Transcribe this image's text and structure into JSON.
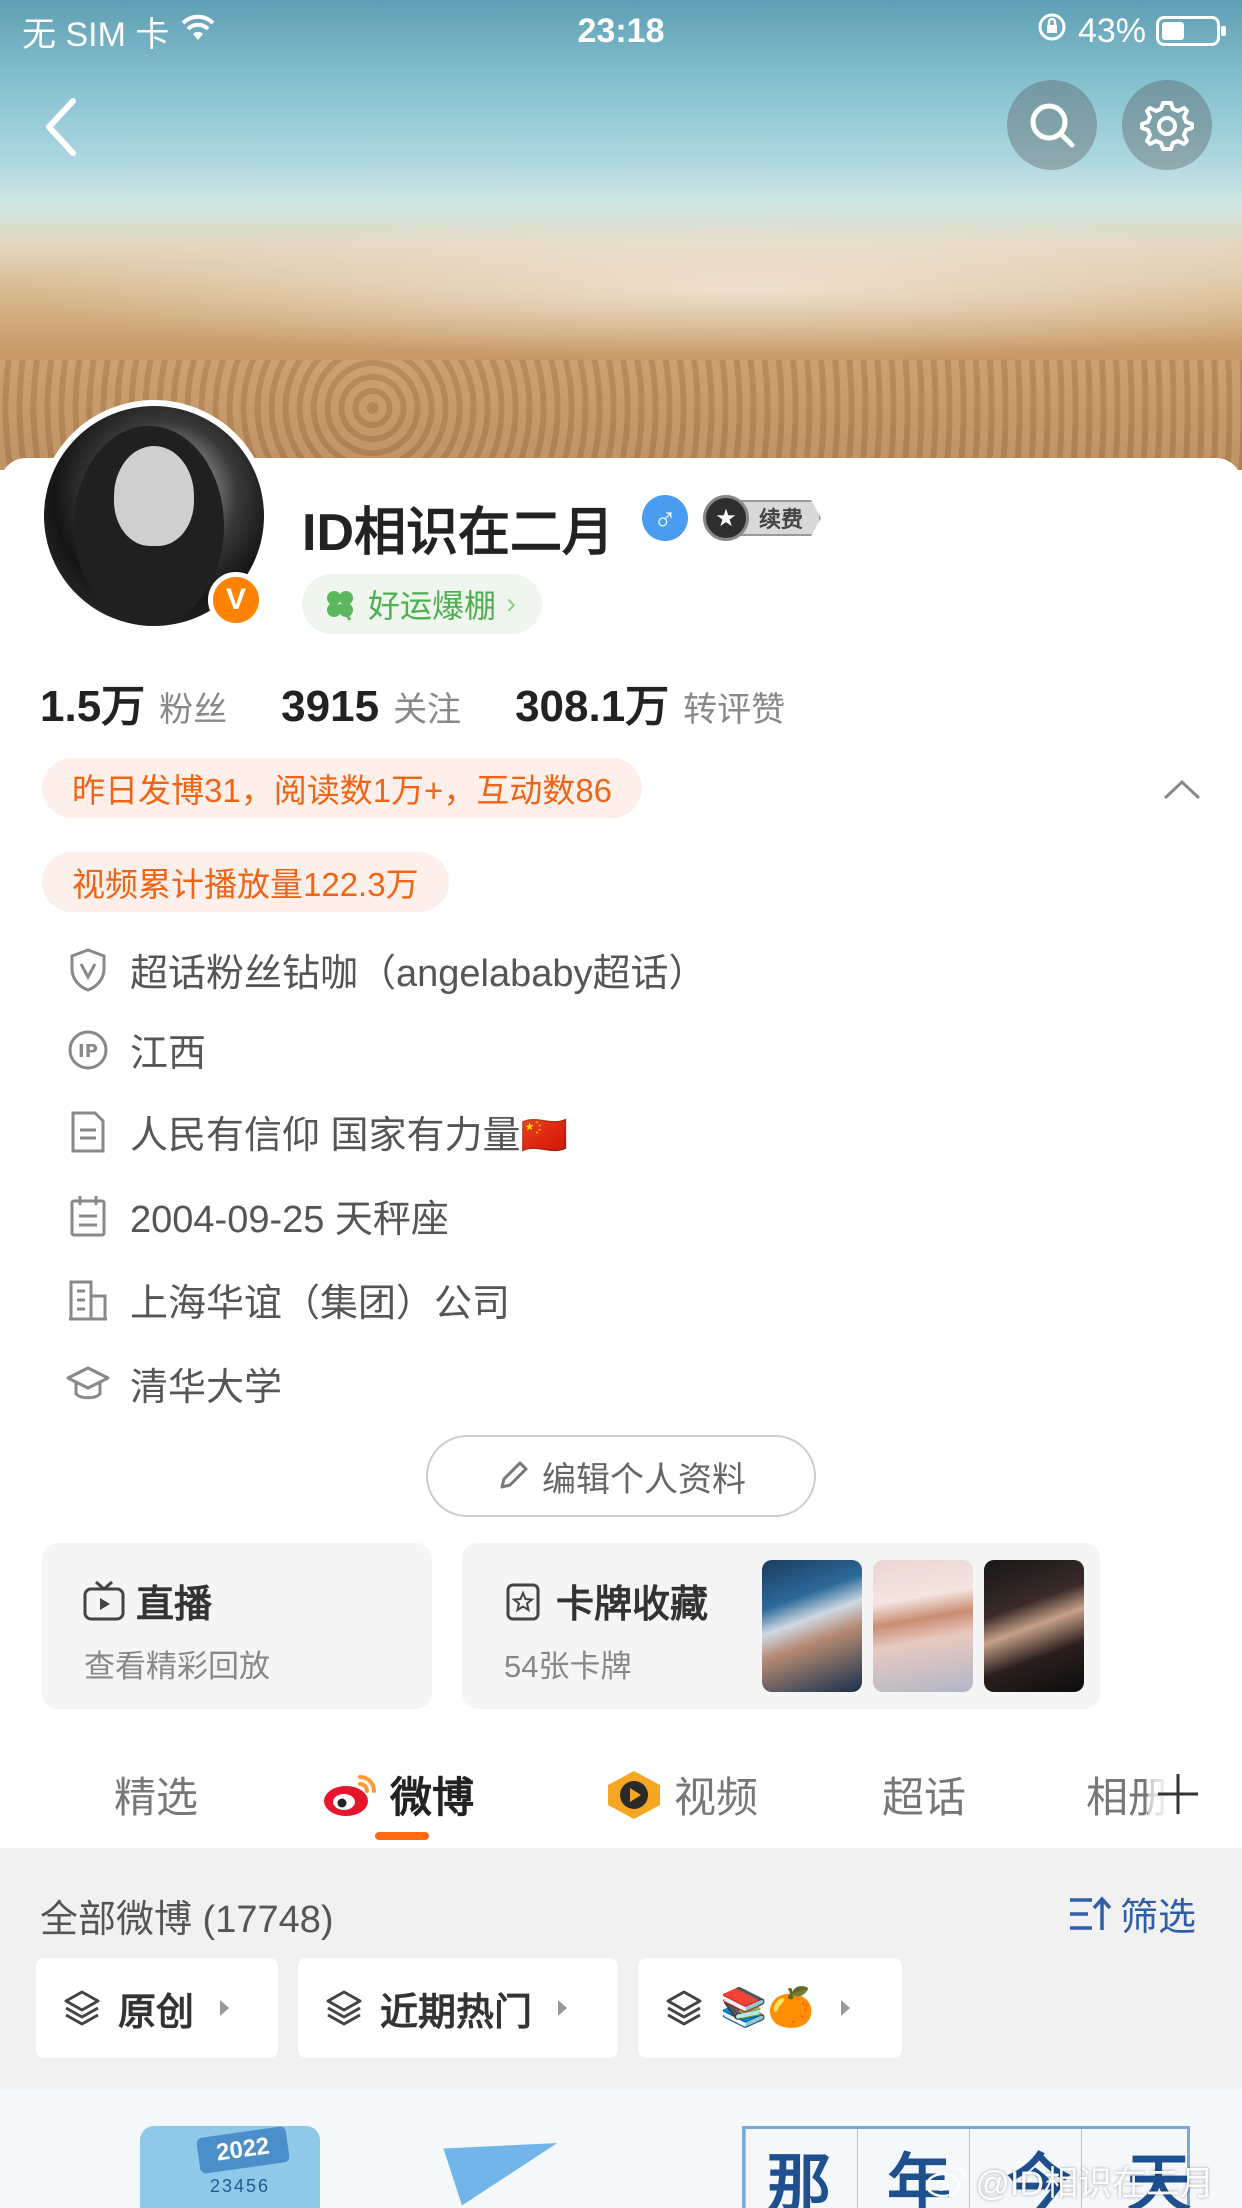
{
  "status_bar": {
    "carrier": "无 SIM 卡",
    "time": "23:18",
    "battery_pct": "43%",
    "battery_level": 0.43
  },
  "profile": {
    "name": "ID相识在二月",
    "member_badge": "续费",
    "luck_label": "好运爆棚",
    "verified_letter": "V"
  },
  "stats": [
    {
      "value": "1.5万",
      "label": "粉丝"
    },
    {
      "value": "3915",
      "label": "关注"
    },
    {
      "value": "308.1万",
      "label": "转评赞"
    }
  ],
  "highlights": {
    "yesterday": "昨日发博31，阅读数1万+，互动数86",
    "video": "视频累计播放量122.3万"
  },
  "info": [
    {
      "icon": "shield-v-icon",
      "text": "超话粉丝钻咖（angelababy超话）"
    },
    {
      "icon": "ip-icon",
      "text": "江西"
    },
    {
      "icon": "document-icon",
      "text": "人民有信仰 国家有力量🇨🇳"
    },
    {
      "icon": "calendar-icon",
      "text": "2004-09-25 天秤座"
    },
    {
      "icon": "building-icon",
      "text": "上海华谊（集团）公司"
    },
    {
      "icon": "graduation-cap-icon",
      "text": "清华大学"
    }
  ],
  "edit_profile_label": "编辑个人资料",
  "tiles": {
    "live": {
      "title": "直播",
      "subtitle": "查看精彩回放"
    },
    "cards": {
      "title": "卡牌收藏",
      "subtitle": "54张卡牌"
    }
  },
  "tabs": [
    "精选",
    "微博",
    "视频",
    "超话",
    "相册"
  ],
  "active_tab": "微博",
  "feed_filter": {
    "all_label": "全部微博 (17748)",
    "filter_label": "筛选",
    "chips": [
      "原创",
      "近期热门",
      "📚🍊"
    ]
  },
  "post_preview": {
    "calendar_year": "2022",
    "calendar_digits": "23456",
    "headline": "那年今天"
  },
  "watermark": "@ID相识在二月",
  "colors": {
    "accent_orange": "#ff8200",
    "highlight_text": "#f06416",
    "highlight_bg": "#fdf0ea",
    "link_blue": "#2f5ea7",
    "luck_green": "#4caf50",
    "tab_underline": "#ff6b13"
  }
}
